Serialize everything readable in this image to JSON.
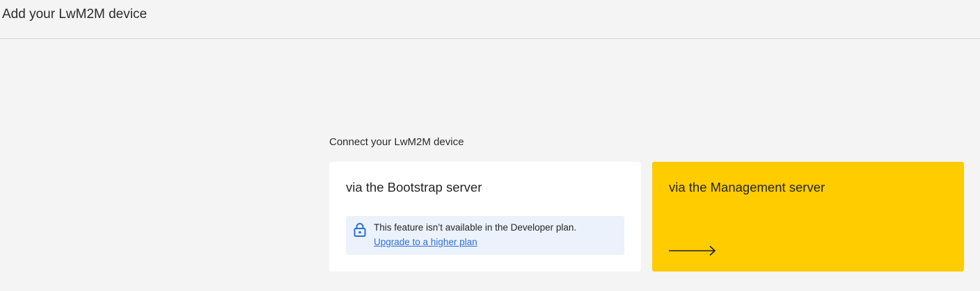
{
  "header": {
    "title": "Add your LwM2M device"
  },
  "main": {
    "section_label": "Connect your LwM2M device",
    "options": [
      {
        "title": "via the Bootstrap server",
        "notice": {
          "icon": "lock-icon",
          "text": "This feature isn’t available in the Developer plan.",
          "link_label": "Upgrade to a higher plan"
        }
      },
      {
        "title": "via the Management server",
        "icon": "arrow-right-icon"
      }
    ]
  },
  "colors": {
    "background": "#f4f4f4",
    "management_card": "#ffcc00",
    "notice_background": "#ebf2fc",
    "link": "#2f6fd6"
  }
}
